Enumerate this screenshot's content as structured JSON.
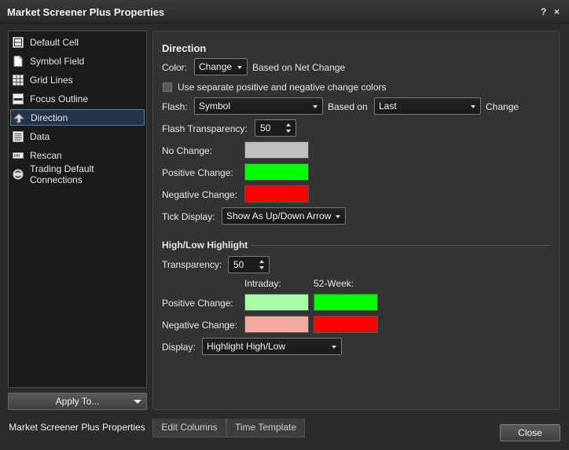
{
  "window": {
    "title": "Market Screener Plus Properties",
    "help_label": "?",
    "close_label": "×"
  },
  "sidebar": {
    "items": [
      {
        "label": "Default Cell",
        "icon": "cell-icon"
      },
      {
        "label": "Symbol Field",
        "icon": "document-icon"
      },
      {
        "label": "Grid Lines",
        "icon": "grid-icon"
      },
      {
        "label": "Focus Outline",
        "icon": "outline-icon"
      },
      {
        "label": "Direction",
        "icon": "direction-icon",
        "selected": true
      },
      {
        "label": "Data",
        "icon": "data-icon"
      },
      {
        "label": "Rescan",
        "icon": "rescan-icon"
      },
      {
        "label": "Trading Default Connections",
        "icon": "connections-icon"
      }
    ],
    "apply_label": "Apply To..."
  },
  "direction": {
    "heading": "Direction",
    "color_label": "Color:",
    "color_value": "Change",
    "color_note": "Based on Net Change",
    "separate_colors_label": "Use separate positive and negative change colors",
    "separate_colors_checked": false,
    "flash_label": "Flash:",
    "flash_value": "Symbol",
    "based_on_label": "Based on",
    "based_on_value": "Last",
    "change_label": "Change",
    "flash_transparency_label": "Flash Transparency:",
    "flash_transparency_value": "50",
    "no_change_label": "No Change:",
    "no_change_color": "#c0c0c0",
    "positive_change_label": "Positive Change:",
    "positive_change_color": "#00ff00",
    "negative_change_label": "Negative Change:",
    "negative_change_color": "#ff0000",
    "tick_display_label": "Tick Display:",
    "tick_display_value": "Show As Up/Down Arrow"
  },
  "highlight": {
    "heading": "High/Low Highlight",
    "transparency_label": "Transparency:",
    "transparency_value": "50",
    "intraday_label": "Intraday:",
    "week52_label": "52-Week:",
    "positive_label": "Positive Change:",
    "negative_label": "Negative Change:",
    "positive_intraday_color": "#a8ffa8",
    "positive_week52_color": "#00ff00",
    "negative_intraday_color": "#f4a8a0",
    "negative_week52_color": "#ff0000",
    "display_label": "Display:",
    "display_value": "Highlight High/Low"
  },
  "tabs": [
    {
      "label": "Market Screener Plus Properties",
      "active": true
    },
    {
      "label": "Edit Columns",
      "active": false
    },
    {
      "label": "Time Template",
      "active": false
    }
  ],
  "footer": {
    "close_label": "Close"
  }
}
